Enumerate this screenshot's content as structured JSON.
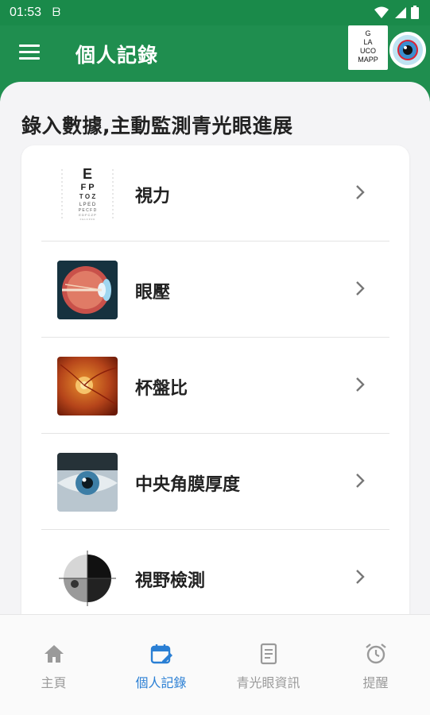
{
  "status_bar": {
    "time": "01:53",
    "notification": "ᗷ"
  },
  "app_bar": {
    "title": "個人記錄",
    "logo_lines": [
      "G",
      "LA",
      "UCO",
      "MAPP"
    ]
  },
  "page": {
    "heading": "錄入數據,主動監測青光眼進展",
    "items": [
      {
        "label": "視力",
        "icon": "eye-chart-icon"
      },
      {
        "label": "眼壓",
        "icon": "eyeball-cross-section-icon"
      },
      {
        "label": "杯盤比",
        "icon": "optic-disc-icon"
      },
      {
        "label": "中央角膜厚度",
        "icon": "eye-closeup-icon"
      },
      {
        "label": "視野檢測",
        "icon": "visual-field-icon"
      }
    ]
  },
  "bottom_nav": [
    {
      "label": "主頁",
      "icon": "home-icon",
      "active": false
    },
    {
      "label": "個人記錄",
      "icon": "calendar-edit-icon",
      "active": true
    },
    {
      "label": "青光眼資訊",
      "icon": "document-icon",
      "active": false
    },
    {
      "label": "提醒",
      "icon": "alarm-clock-icon",
      "active": false
    }
  ],
  "colors": {
    "primary": "#1f8e4f",
    "active_nav": "#2a7fd4",
    "inactive_nav": "#9a9a9a"
  }
}
